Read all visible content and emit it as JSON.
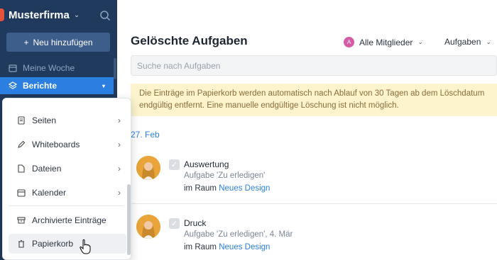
{
  "sidebar": {
    "brand": "Musterfirma",
    "add_button": "Neu hinzufügen",
    "items": [
      {
        "label": "Meine Woche"
      },
      {
        "label": "Berichte"
      }
    ]
  },
  "popup_menu": {
    "items": [
      {
        "label": "Seiten"
      },
      {
        "label": "Whiteboards"
      },
      {
        "label": "Dateien"
      },
      {
        "label": "Kalender"
      },
      {
        "label": "Archivierte Einträge"
      },
      {
        "label": "Papierkorb"
      }
    ]
  },
  "main": {
    "title": "Gelöschte Aufgaben",
    "member_filter": "Alle Mitglieder",
    "member_initial": "A",
    "type_filter": "Aufgaben",
    "search_placeholder": "Suche nach Aufgaben",
    "notice": "Die Einträge im Papierkorb werden automatisch nach Ablauf von 30 Tagen ab dem Löschdatum endgültig entfernt. Eine manuelle endgültige Löschung ist nicht möglich.",
    "date_group": "27. Feb",
    "entries": [
      {
        "title": "Auswertung",
        "subtitle": "Aufgabe 'Zu erledigen'",
        "room_prefix": "im Raum",
        "room": "Neues Design"
      },
      {
        "title": "Druck",
        "subtitle": "Aufgabe 'Zu erledigen', 4. Mär",
        "room_prefix": "im Raum",
        "room": "Neues Design"
      }
    ]
  },
  "colors": {
    "sidebar": "#1f3a5c",
    "accent": "#2a7fe0",
    "notice_bg": "#fdf3cd"
  }
}
